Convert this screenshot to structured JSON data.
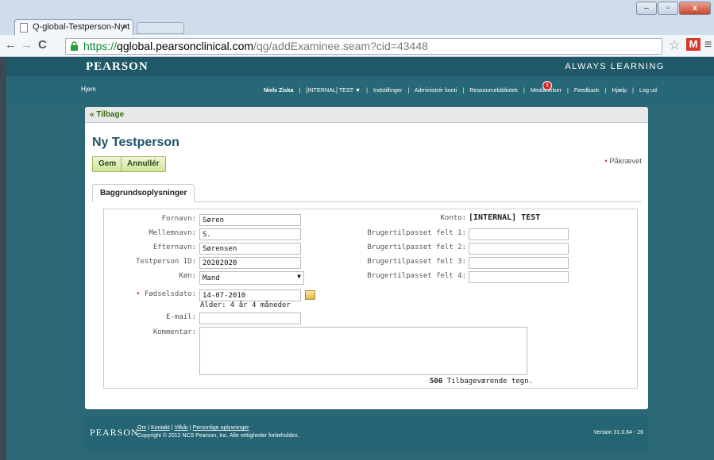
{
  "browser": {
    "tab_title": "Q-global-Testperson-Ny t",
    "tab_close": "×",
    "url_scheme": "https://",
    "url_host": "qglobal.pearsonclinical.com",
    "url_path": "/qg/addExaminee.seam?cid=43448",
    "gmail_label": "M"
  },
  "header": {
    "brand": "PEARSON",
    "tagline": "ALWAYS LEARNING"
  },
  "nav": {
    "home": "Hjem",
    "user": "Niels Ziska",
    "account": "[INTERNAL] TEST ▼",
    "settings": "Indstillinger",
    "admin": "Administrér konti",
    "library": "Ressourcebibliotek",
    "messages": "Meddelelser",
    "badge": "1",
    "feedback": "Feedback",
    "help": "Hjælp",
    "logout": "Log ud",
    "sep": "|"
  },
  "panel": {
    "back": "« Tilbage",
    "title": "Ny Testperson",
    "save": "Gem",
    "cancel": "Annullér",
    "required_star": "•",
    "required": "Påkrævet",
    "tab": "Baggrundsoplysninger"
  },
  "form": {
    "first_name_label": "Fornavn:",
    "first_name": "Søren",
    "middle_name_label": "Mellemnavn:",
    "middle_name": "S.",
    "last_name_label": "Efternavn:",
    "last_name": "Sørensen",
    "id_label": "Testperson ID:",
    "id": "20202020",
    "gender_label": "Køn:",
    "gender": "Mand",
    "dob_star": "•",
    "dob_label": "Fødselsdato:",
    "dob": "14-07-2010",
    "age": "Alder: 4 år 4 måneder",
    "email_label": "E-mail:",
    "email": "",
    "comment_label": "Kommentar:",
    "remaining_count": "500",
    "remaining_text": "Tilbageværende tegn.",
    "konto_label": "Konto:",
    "konto": "[INTERNAL] TEST",
    "custom1_label": "Brugertilpasset felt 1:",
    "custom2_label": "Brugertilpasset felt 2:",
    "custom3_label": "Brugertilpasset felt 3:",
    "custom4_label": "Brugertilpasset felt 4:"
  },
  "footer": {
    "brand": "PEARSON",
    "link_about": "Om",
    "link_contact": "Kontakt",
    "link_terms": "Vilkår",
    "link_privacy": "Personlige oplysninger",
    "copyright": "Copyright © 2012 NCS Pearson, Inc. Alle rettigheder forbeholdes.",
    "version": "Version 31.0.64 - 26"
  }
}
